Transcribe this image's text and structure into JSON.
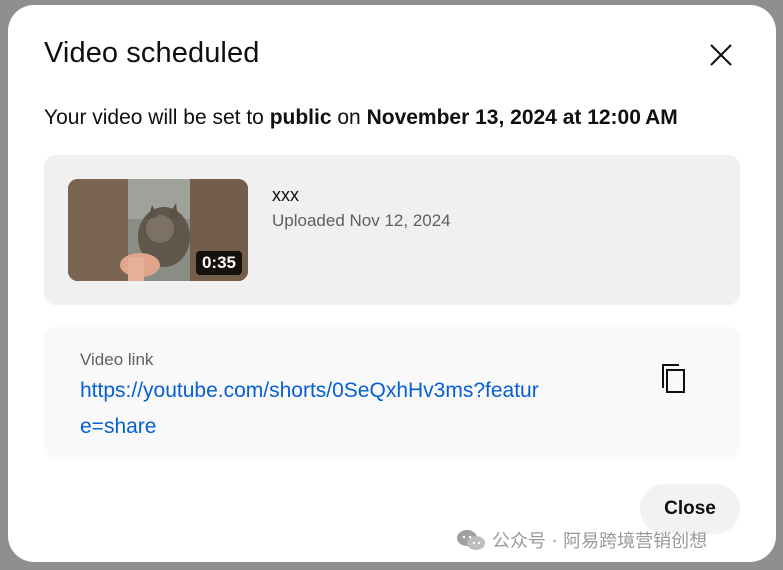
{
  "dialog": {
    "title": "Video scheduled",
    "schedule": {
      "prefix": "Your video will be set to ",
      "visibility": "public",
      "connector": " on ",
      "datetime": "November 13, 2024 at 12:00 AM"
    },
    "video": {
      "title": "xxx",
      "uploaded": "Uploaded Nov 12, 2024",
      "duration": "0:35"
    },
    "link": {
      "label": "Video link",
      "url": "https://youtube.com/shorts/0SeQxhHv3ms?feature=share"
    },
    "close_button": "Close"
  },
  "watermark": {
    "text": "公众号 · 阿易跨境营销创想",
    "icon": "wechat-icon"
  },
  "colors": {
    "link": "#065fd4",
    "text": "#0f0f0f",
    "secondary": "#606060",
    "card_bg": "#f0f0f0"
  }
}
